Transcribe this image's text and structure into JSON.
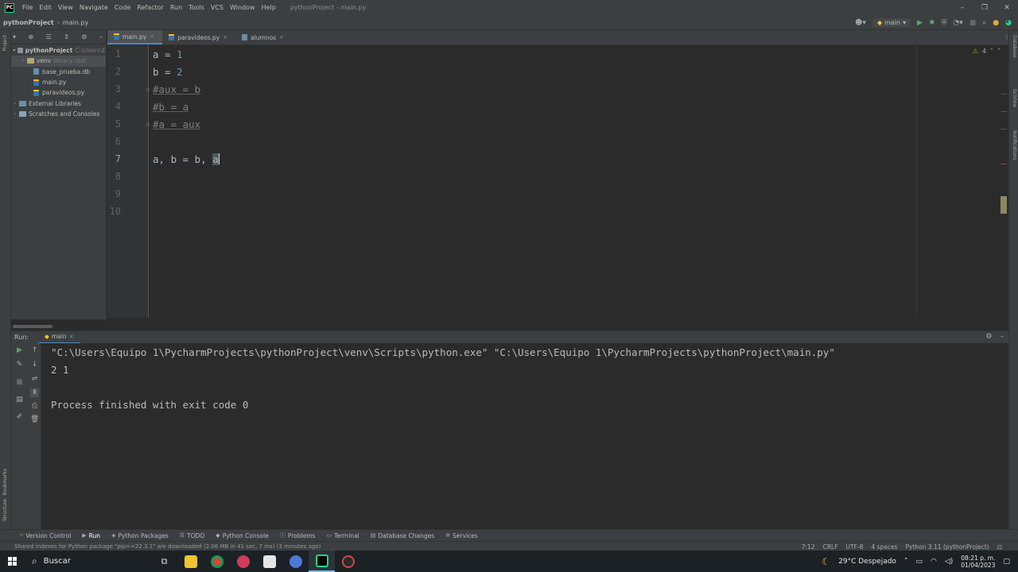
{
  "menubar": {
    "items": [
      "File",
      "Edit",
      "View",
      "Navigate",
      "Code",
      "Refactor",
      "Run",
      "Tools",
      "VCS",
      "Window",
      "Help"
    ],
    "window_title": "pythonProject - main.py"
  },
  "navbar": {
    "project": "pythonProject",
    "file": "main.py",
    "run_config": "main"
  },
  "project_panel": {
    "label": "Project",
    "root": "pythonProject",
    "root_path": "C:\\Users\\E",
    "items": [
      {
        "name": "venv",
        "note": "library root"
      },
      {
        "name": "base_prueba.db"
      },
      {
        "name": "main.py"
      },
      {
        "name": "paravideos.py"
      },
      {
        "name": "External Libraries"
      },
      {
        "name": "Scratches and Consoles"
      }
    ]
  },
  "tabs": [
    "main.py",
    "paravideos.py",
    "alumnos"
  ],
  "editor": {
    "line_numbers": [
      "1",
      "2",
      "3",
      "4",
      "5",
      "6",
      "7",
      "8",
      "9",
      "10"
    ],
    "lines": [
      {
        "t": "a = ",
        "n": "1"
      },
      {
        "t": "b = ",
        "n": "2"
      },
      {
        "c": "#aux = b"
      },
      {
        "c": "#b = a"
      },
      {
        "c": "#a = aux"
      },
      {
        "t": ""
      },
      {
        "t": "a, b = b, ",
        "cur": "a"
      },
      {
        "t": ""
      },
      {
        "t": ""
      },
      {
        "t": ""
      }
    ],
    "inspection_count": "4"
  },
  "run_panel": {
    "title": "Run:",
    "tab": "main",
    "output": [
      "\"C:\\Users\\Equipo 1\\PycharmProjects\\pythonProject\\venv\\Scripts\\python.exe\" \"C:\\Users\\Equipo 1\\PycharmProjects\\pythonProject\\main.py\"",
      "2 1",
      "",
      "Process finished with exit code 0"
    ]
  },
  "tool_windows": [
    "Version Control",
    "Run",
    "Python Packages",
    "TODO",
    "Python Console",
    "Problems",
    "Terminal",
    "Database Changes",
    "Services"
  ],
  "side_labels": {
    "left": [
      "Project",
      "Bookmarks",
      "Structure"
    ],
    "right": [
      "Database",
      "SciView",
      "Notifications"
    ]
  },
  "status": {
    "message": "Shared indexes for Python package \"pip==22.3.1\" are downloaded (2.06 MB in 41 sec, 7 ms) (3 minutes ago)",
    "position": "7:12",
    "line_sep": "CRLF",
    "encoding": "UTF-8",
    "indent": "4 spaces",
    "interpreter": "Python 3.11 (pythonProject)"
  },
  "taskbar": {
    "search": "Buscar",
    "weather": "29°C  Despejado",
    "time": "08:21 p. m.",
    "date": "01/04/2023"
  },
  "colors": {
    "accent": "#4a88c7",
    "number": "#6897bb",
    "comment": "#808080"
  }
}
